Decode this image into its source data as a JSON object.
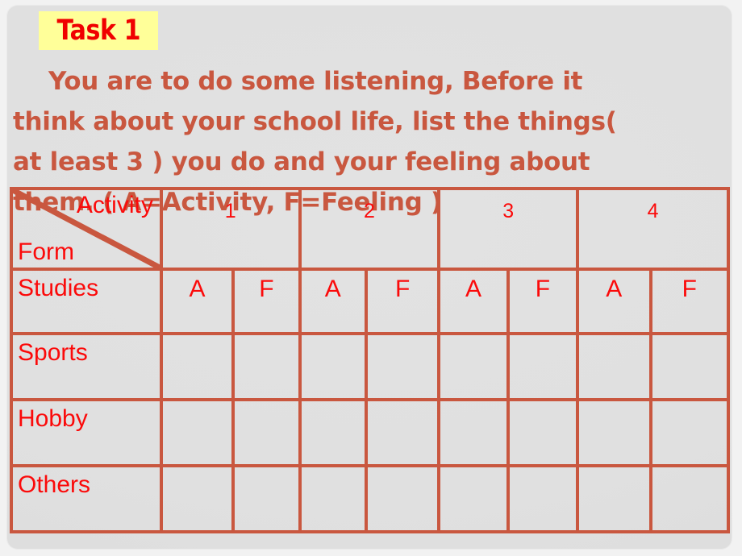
{
  "slide": {
    "background_color": "#e0e0e0",
    "accent_color": "#c9573f",
    "text_red": "#fb0a0a",
    "badge_bg": "#ffff99"
  },
  "badge": {
    "label": "Task 1"
  },
  "instruction": {
    "lines": [
      "You are to do some listening, Before it",
      "think about your school life, list the things(",
      "at least 3 ) you do and your feeling about",
      "them. ( A=Activity, F=Feeling )"
    ]
  },
  "table": {
    "corner": {
      "top_right_label": "Activity",
      "bottom_left_label": "Form",
      "diagonal": true
    },
    "group_headers": [
      "1",
      "2",
      "3",
      "4"
    ],
    "sub_headers": [
      "A",
      "F",
      "A",
      "F",
      "A",
      "F",
      "A",
      "F"
    ],
    "row_labels": [
      "Studies",
      "Sports",
      "Hobby",
      "Others"
    ],
    "rows": [
      {
        "label": "Studies",
        "cells": [
          "",
          "",
          "",
          "",
          "",
          "",
          "",
          ""
        ]
      },
      {
        "label": "Sports",
        "cells": [
          "",
          "",
          "",
          "",
          "",
          "",
          "",
          ""
        ]
      },
      {
        "label": "Hobby",
        "cells": [
          "",
          "",
          "",
          "",
          "",
          "",
          "",
          ""
        ]
      },
      {
        "label": "Others",
        "cells": [
          "",
          "",
          "",
          "",
          "",
          "",
          "",
          ""
        ]
      }
    ]
  }
}
